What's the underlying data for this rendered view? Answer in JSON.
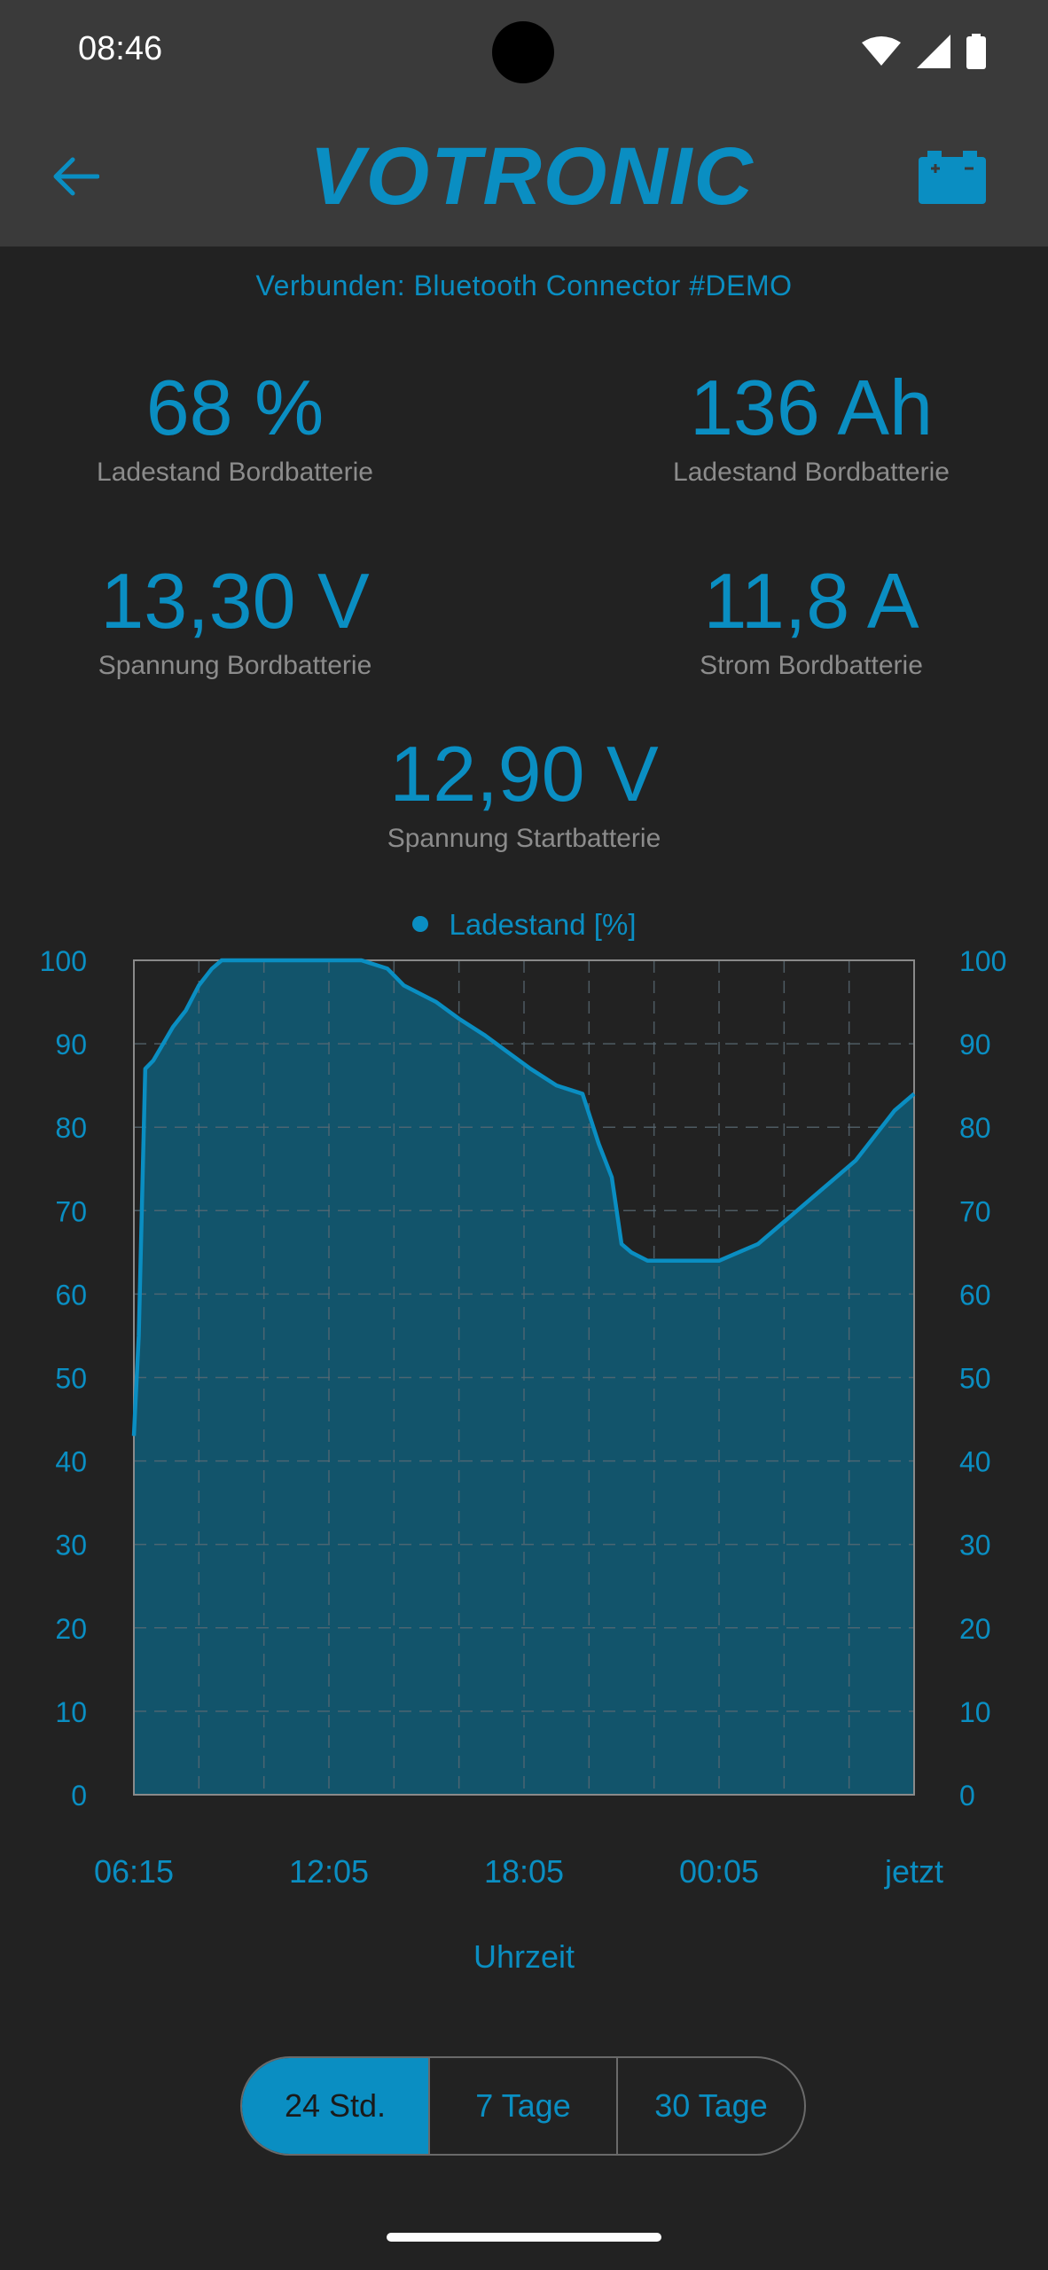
{
  "status_bar": {
    "time": "08:46",
    "icons": [
      "wifi-icon",
      "signal-icon",
      "battery-icon"
    ]
  },
  "app_bar": {
    "back_icon": "arrow-left-icon",
    "logo_text": "VOTRONIC",
    "action_icon": "car-battery-icon"
  },
  "connection_status": "Verbunden: Bluetooth Connector #DEMO",
  "metrics": {
    "soc_percent": {
      "value": "68 %",
      "label": "Ladestand Bordbatterie"
    },
    "soc_ah": {
      "value": "136 Ah",
      "label": "Ladestand Bordbatterie"
    },
    "voltage_board": {
      "value": "13,30 V",
      "label": "Spannung Bordbatterie"
    },
    "current_board": {
      "value": "11,8 A",
      "label": "Strom Bordbatterie"
    },
    "voltage_start": {
      "value": "12,90 V",
      "label": "Spannung Startbatterie"
    }
  },
  "colors": {
    "accent": "#0a8ec2",
    "background": "#222222",
    "bar": "#3a3a3a",
    "fill": "#12546b",
    "label_grey": "#8c8c8c"
  },
  "chart_data": {
    "type": "area",
    "legend": "Ladestand [%]",
    "xlabel": "Uhrzeit",
    "x_ticks": [
      "06:15",
      "12:05",
      "18:05",
      "00:05",
      "jetzt"
    ],
    "ylim": [
      0,
      100
    ],
    "y_ticks": [
      0,
      10,
      20,
      30,
      40,
      50,
      60,
      70,
      80,
      90,
      100
    ],
    "grid": true,
    "legend_position": "top-center",
    "x_hours": [
      0,
      0.15,
      0.35,
      0.6,
      0.9,
      1.2,
      1.6,
      2.0,
      2.4,
      2.7,
      3.2,
      4.0,
      5.0,
      6.0,
      7.0,
      7.8,
      8.3,
      8.8,
      9.3,
      10.0,
      10.8,
      11.5,
      12.2,
      13.0,
      13.8,
      14.3,
      14.7,
      15.0,
      15.3,
      15.8,
      16.5,
      17.3,
      18.0,
      18.6,
      19.2,
      19.8,
      20.4,
      21.0,
      21.6,
      22.2,
      22.8,
      23.4,
      24.0
    ],
    "values": [
      43,
      55,
      87,
      88,
      90,
      92,
      94,
      97,
      99,
      100,
      100,
      100,
      100,
      100,
      100,
      99,
      97,
      96,
      95,
      93,
      91,
      89,
      87,
      85,
      84,
      78,
      74,
      66,
      65,
      64,
      64,
      64,
      64,
      65,
      66,
      68,
      70,
      72,
      74,
      76,
      79,
      82,
      84
    ]
  },
  "range_toggle": {
    "options": [
      "24 Std.",
      "7 Tage",
      "30 Tage"
    ],
    "selected": 0
  }
}
